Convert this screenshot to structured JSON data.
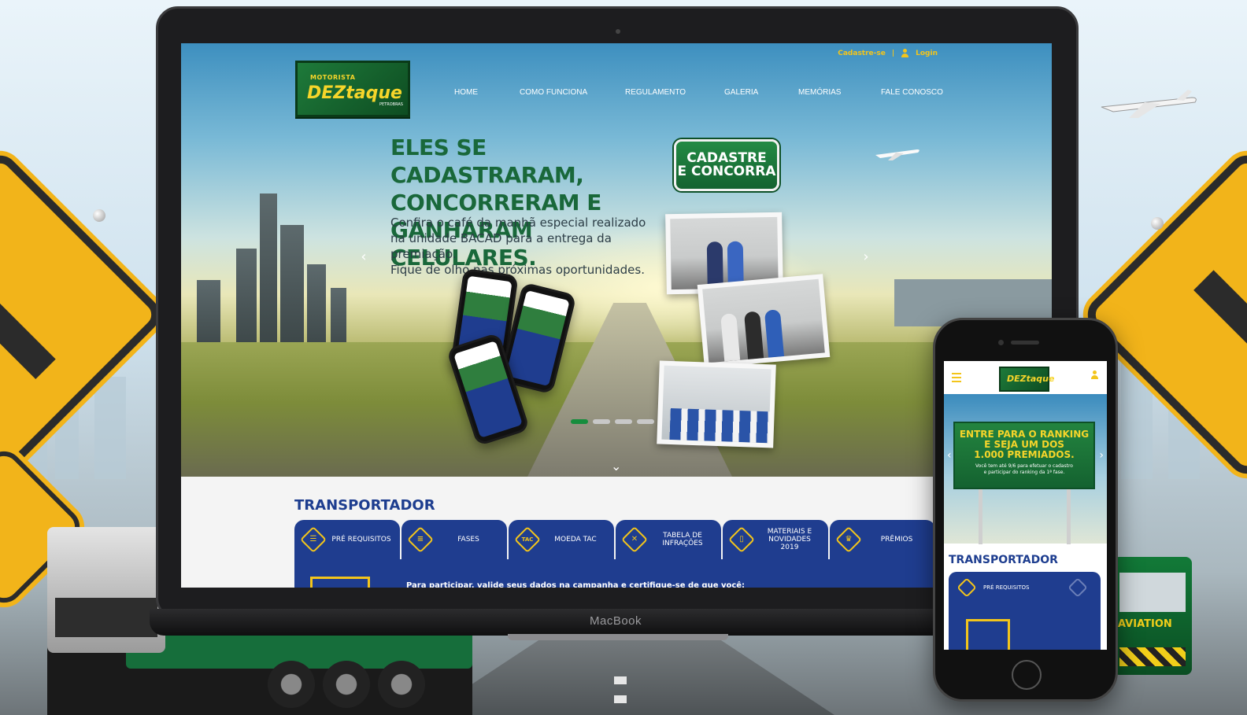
{
  "laptop": {
    "brand": "MacBook",
    "site": {
      "logo": {
        "small": "MOTORISTA",
        "main": "DEZtaque",
        "sub": "PETROBRAS"
      },
      "top_links": {
        "register": "Cadastre-se",
        "separator": "|",
        "login": "Login"
      },
      "nav": [
        "HOME",
        "COMO FUNCIONA",
        "REGULAMENTO",
        "GALERIA",
        "MEMÓRIAS",
        "FALE CONOSCO"
      ],
      "hero": {
        "headline": [
          "ELES SE CADASTRARAM,",
          "CONCORRERAM E",
          "GANHARAM CELULARES."
        ],
        "subtext": [
          "Confira o café da manhã especial realizado",
          "na unidade BACAD para a entrega da premiação.",
          "Fique de olho nas próximas oportunidades."
        ],
        "cta": [
          "CADASTRE",
          "E CONCORRA"
        ],
        "prev_arrow": "‹",
        "next_arrow": "›",
        "slides_count": 4,
        "active_slide": 1,
        "scroll_down": "⌄"
      },
      "transportador": {
        "title": "TRANSPORTADOR",
        "tabs": [
          {
            "label": "PRÉ REQUISITOS",
            "icon": "checklist-icon",
            "glyph": "☰"
          },
          {
            "label": "FASES",
            "icon": "list-icon",
            "glyph": "≡"
          },
          {
            "label": "MOEDA TAC",
            "icon": "coin-icon",
            "glyph": "TAC"
          },
          {
            "label": "TABELA DE INFRAÇÕES",
            "icon": "close-icon",
            "glyph": "✕"
          },
          {
            "label": "MATERIAIS E NOVIDADES 2019",
            "icon": "book-icon",
            "glyph": "▯"
          },
          {
            "label": "PRÊMIOS",
            "icon": "trophy-icon",
            "glyph": "♛"
          }
        ],
        "panel_text": "Para participar, valide seus dados na campanha e certifique-se de que você:"
      }
    }
  },
  "phone": {
    "logo": "DEZtaque",
    "billboard": {
      "title": [
        "ENTRE PARA O RANKING",
        "E SEJA UM DOS",
        "1.000 PREMIADOS."
      ],
      "note": [
        "Você tem até 9/6 para efetuar o cadastro",
        "e participar do ranking da 1ª fase."
      ]
    },
    "prev_arrow": "‹",
    "next_arrow": "›",
    "transportador_title": "TRANSPORTADOR",
    "tab_label": "PRÉ REQUISITOS"
  },
  "truck": {
    "label": "AVIATION"
  },
  "colors": {
    "brand_green": "#19683a",
    "brand_yellow": "#f3c51b",
    "brand_blue": "#1f3d8f"
  }
}
